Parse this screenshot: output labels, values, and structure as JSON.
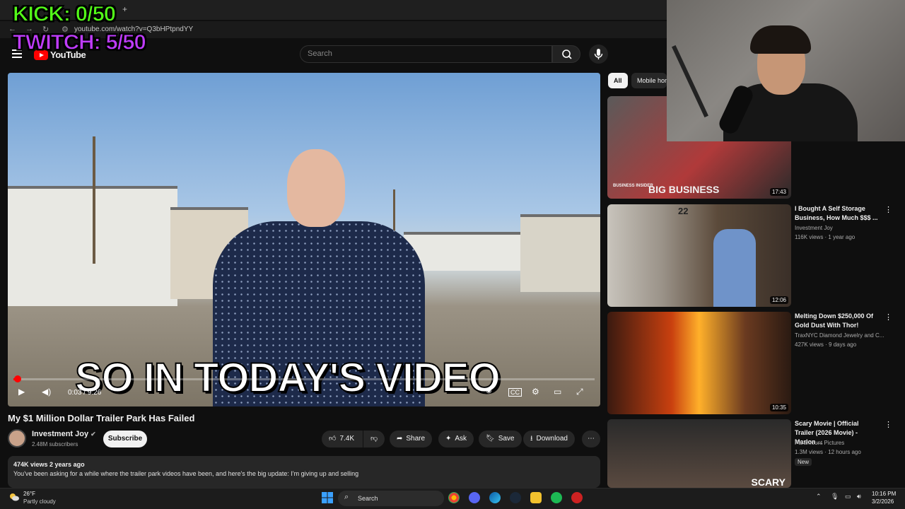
{
  "overlay": {
    "kick": "KICK: 0/50",
    "twitch": "TWITCH: 5/50"
  },
  "browser": {
    "url": "youtube.com/watch?v=Q3bHPtpndYY",
    "new_tab": "+"
  },
  "header": {
    "logo_text": "YouTube",
    "search_placeholder": "Search"
  },
  "video": {
    "caption": "SO IN TODAY'S VIDEO",
    "time": "0:03 / 9:26",
    "progress_fraction": 0.005,
    "title": "My $1 Million Dollar Trailer Park Has Failed"
  },
  "channel": {
    "name": "Investment Joy",
    "subs": "2.48M subscribers",
    "subscribe_label": "Subscribe"
  },
  "actions": {
    "likes": "7.4K",
    "share": "Share",
    "ask": "Ask",
    "save": "Save",
    "download": "Download"
  },
  "description": {
    "meta": "474K views  2 years ago",
    "text": "You've been asking for a while where the trailer park videos have been, and here's the big update: I'm giving up and selling"
  },
  "sidebar": {
    "chips": [
      "All",
      "Mobile home"
    ],
    "recommendations": [
      {
        "title": "",
        "channel": "",
        "meta": "",
        "duration": "17:43",
        "thumb_text": "BIG BUSINESS",
        "thumb_brand": "BUSINESS INSIDER"
      },
      {
        "title": "I Bought A Self Storage Business, How Much $$$ ...",
        "channel": "Investment Joy",
        "meta": "116K views · 1 year ago",
        "duration": "12:06",
        "thumb_text": "22"
      },
      {
        "title": "Melting Down $250,000 Of Gold Dust With Thor!",
        "channel": "TraxNYC Diamond Jewelry  and C...",
        "meta": "427K views · 9 days ago",
        "duration": "10:35"
      },
      {
        "title": "Scary Movie | Official Trailer (2026 Movie) - Marlon ...",
        "channel": "Paramount Pictures",
        "meta": "1.3M views · 12 hours ago",
        "badge": "New",
        "thumb_text": "SCARY"
      }
    ]
  },
  "taskbar": {
    "weather_temp": "26°F",
    "weather_cond": "Partly cloudy",
    "search": "Search",
    "time": "10:16 PM",
    "date": "3/2/2026"
  },
  "colors": {
    "kick": "#53fc18",
    "twitch": "#c03cff",
    "yt_red": "#ff0000",
    "bg": "#0f0f0f"
  }
}
